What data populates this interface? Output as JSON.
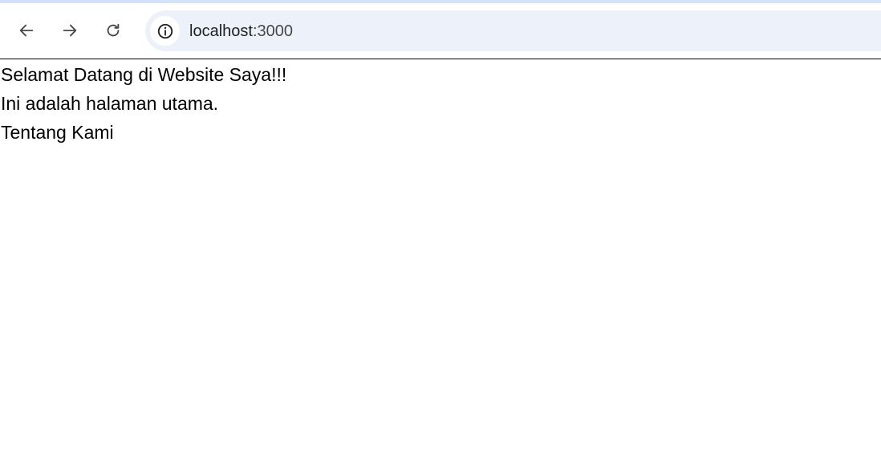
{
  "browser": {
    "url_host": "localhost",
    "url_port": ":3000",
    "icons": {
      "back": "arrow-left-icon",
      "forward": "arrow-right-icon",
      "reload": "reload-icon",
      "site_info": "info-icon"
    },
    "colors": {
      "top_strip": "#d3e3fd",
      "omnibox_bg": "#edf2fa"
    }
  },
  "page": {
    "heading": "Selamat Datang di Website Saya!!!",
    "paragraph": "Ini adalah halaman utama.",
    "link": "Tentang Kami"
  }
}
